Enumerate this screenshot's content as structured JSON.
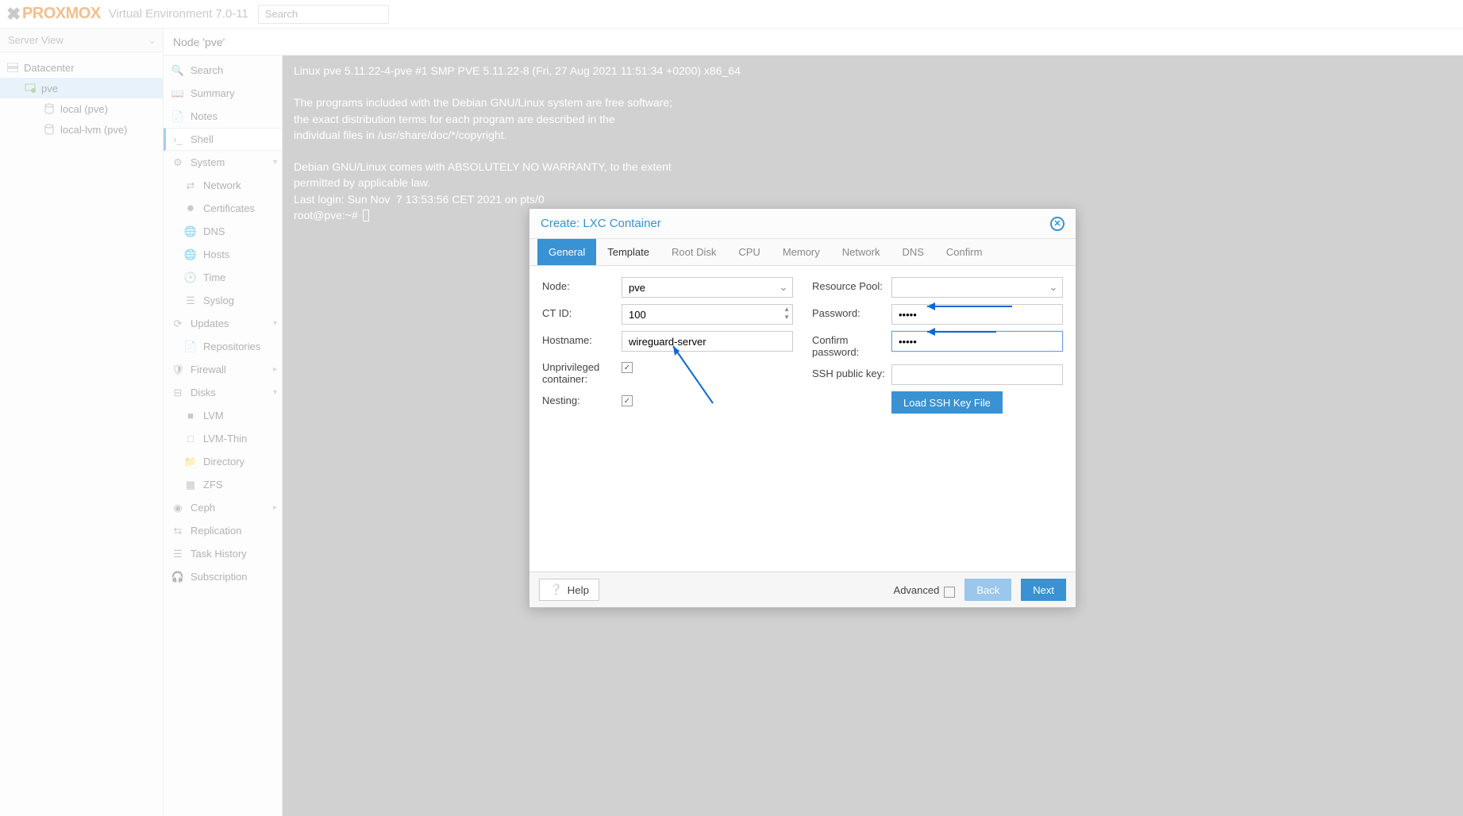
{
  "header": {
    "logo_text": "PROXMOX",
    "ve_label": "Virtual Environment 7.0-11",
    "search_placeholder": "Search"
  },
  "left_sidebar": {
    "view": "Server View",
    "items": {
      "datacenter": "Datacenter",
      "pve": "pve",
      "local": "local (pve)",
      "locallvm": "local-lvm (pve)"
    }
  },
  "center": {
    "breadcrumb": "Node 'pve'"
  },
  "mid_nav": {
    "search": "Search",
    "summary": "Summary",
    "notes": "Notes",
    "shell": "Shell",
    "system": "System",
    "network": "Network",
    "certificates": "Certificates",
    "dns": "DNS",
    "hosts": "Hosts",
    "time": "Time",
    "syslog": "Syslog",
    "updates": "Updates",
    "repositories": "Repositories",
    "firewall": "Firewall",
    "disks": "Disks",
    "lvm": "LVM",
    "lvmthin": "LVM-Thin",
    "directory": "Directory",
    "zfs": "ZFS",
    "ceph": "Ceph",
    "replication": "Replication",
    "taskhistory": "Task History",
    "subscription": "Subscription"
  },
  "terminal": {
    "content": "Linux pve 5.11.22-4-pve #1 SMP PVE 5.11.22-8 (Fri, 27 Aug 2021 11:51:34 +0200) x86_64\n\nThe programs included with the Debian GNU/Linux system are free software;\nthe exact distribution terms for each program are described in the\nindividual files in /usr/share/doc/*/copyright.\n\nDebian GNU/Linux comes with ABSOLUTELY NO WARRANTY, to the extent\npermitted by applicable law.\nLast login: Sun Nov  7 13:53:56 CET 2021 on pts/0\nroot@pve:~# "
  },
  "modal": {
    "title": "Create: LXC Container",
    "tabs": {
      "general": "General",
      "template": "Template",
      "rootdisk": "Root Disk",
      "cpu": "CPU",
      "memory": "Memory",
      "network": "Network",
      "dns": "DNS",
      "confirm": "Confirm"
    },
    "labels": {
      "node": "Node:",
      "ctid": "CT ID:",
      "hostname": "Hostname:",
      "unprivileged": "Unprivileged container:",
      "nesting": "Nesting:",
      "respool": "Resource Pool:",
      "password": "Password:",
      "confirmpw": "Confirm password:",
      "sshkey": "SSH public key:",
      "loadssh": "Load SSH Key File"
    },
    "values": {
      "node": "pve",
      "ctid": "100",
      "hostname": "wireguard-server",
      "password": "•••••",
      "confirmpw": "•••••",
      "respool": "",
      "sshkey": ""
    },
    "footer": {
      "help": "Help",
      "advanced": "Advanced",
      "back": "Back",
      "next": "Next"
    }
  }
}
